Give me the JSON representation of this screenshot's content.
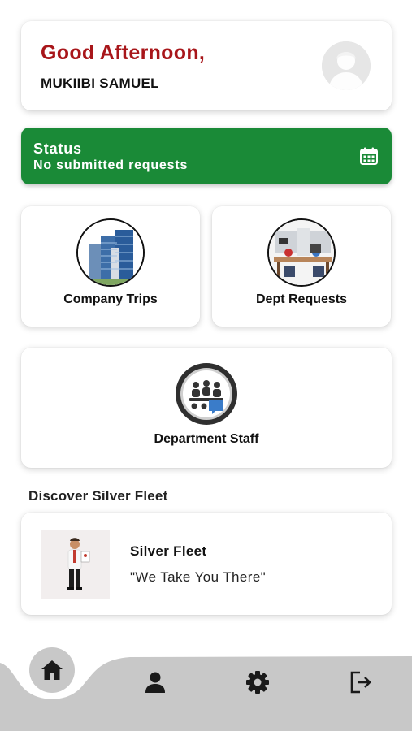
{
  "greeting": {
    "text": "Good Afternoon,",
    "user_name": "MUKIIBI SAMUEL",
    "avatar_icon": "user-avatar-icon"
  },
  "status": {
    "title": "Status",
    "text": "No submitted requests",
    "icon": "calendar-icon",
    "color": "#1a8a37"
  },
  "tiles": [
    {
      "label": "Company Trips",
      "icon": "buildings-image"
    },
    {
      "label": "Dept Requests",
      "icon": "office-desk-image"
    },
    {
      "label": "Department Staff",
      "icon": "team-meeting-icon"
    }
  ],
  "discover": {
    "heading": "Discover Silver Fleet",
    "card": {
      "title": "Silver Fleet",
      "tagline": "\"We Take You There\"",
      "image": "businessman-image"
    }
  },
  "nav": {
    "items": [
      "home-icon",
      "profile-icon",
      "settings-icon",
      "logout-icon"
    ],
    "active": "home-icon"
  },
  "colors": {
    "accent_red": "#a8161a",
    "status_green": "#1a8a37",
    "nav_bg": "#c8c8c8"
  }
}
